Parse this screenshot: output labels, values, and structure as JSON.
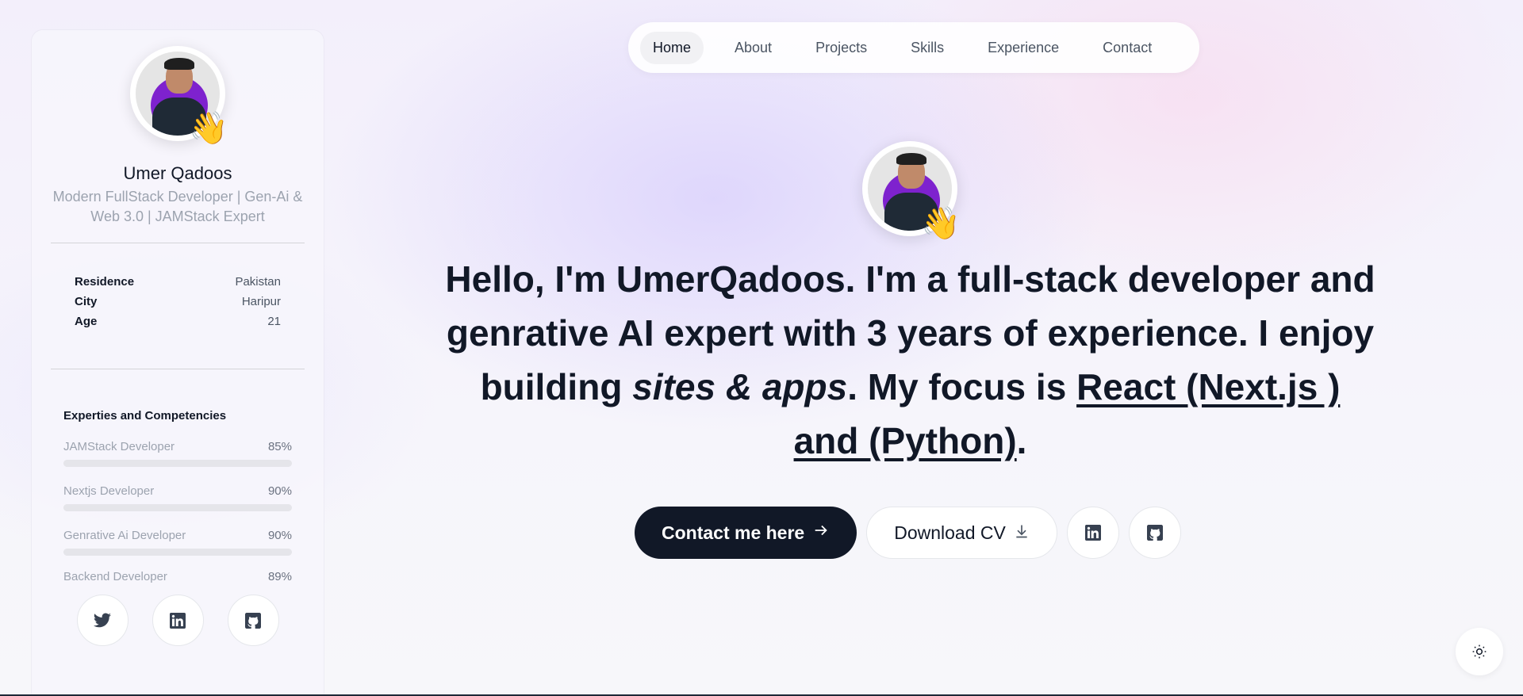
{
  "sidebar": {
    "name": "Umer Qadoos",
    "role": "Modern FullStack Developer | Gen-Ai & Web 3.0 | JAMStack Expert",
    "info": [
      {
        "label": "Residence",
        "value": "Pakistan"
      },
      {
        "label": "City",
        "value": "Haripur"
      },
      {
        "label": "Age",
        "value": "21"
      }
    ],
    "skills_title": "Experties and Competencies",
    "skills": [
      {
        "name": "JAMStack Developer",
        "percent_label": "85%",
        "value": 85
      },
      {
        "name": "Nextjs Developer",
        "percent_label": "90%",
        "value": 90
      },
      {
        "name": "Genrative Ai Developer",
        "percent_label": "90%",
        "value": 90
      },
      {
        "name": "Backend Developer",
        "percent_label": "89%",
        "value": 89
      }
    ],
    "socials": [
      "twitter-icon",
      "linkedin-icon",
      "github-icon"
    ]
  },
  "nav": {
    "items": [
      "Home",
      "About",
      "Projects",
      "Skills",
      "Experience",
      "Contact"
    ],
    "active": "Home"
  },
  "hero": {
    "greeting_bold": "Hello, I'm UmerQadoos.",
    "t1": " I'm a ",
    "b1": "full-stack developer",
    "t2": " and ",
    "b2": "genrative AI expert",
    "t3": " with ",
    "b3": "3 years",
    "t4": " of experience. I enjoy building ",
    "i1": "sites & apps",
    "t5": ". My focus is ",
    "u1": "React (Next.js ) and (Python)",
    "t6": "."
  },
  "actions": {
    "contact_label": "Contact me here",
    "cv_label": "Download CV"
  },
  "colors": {
    "primary_button": "#111827",
    "avatar_accent": "#7e22ce"
  }
}
